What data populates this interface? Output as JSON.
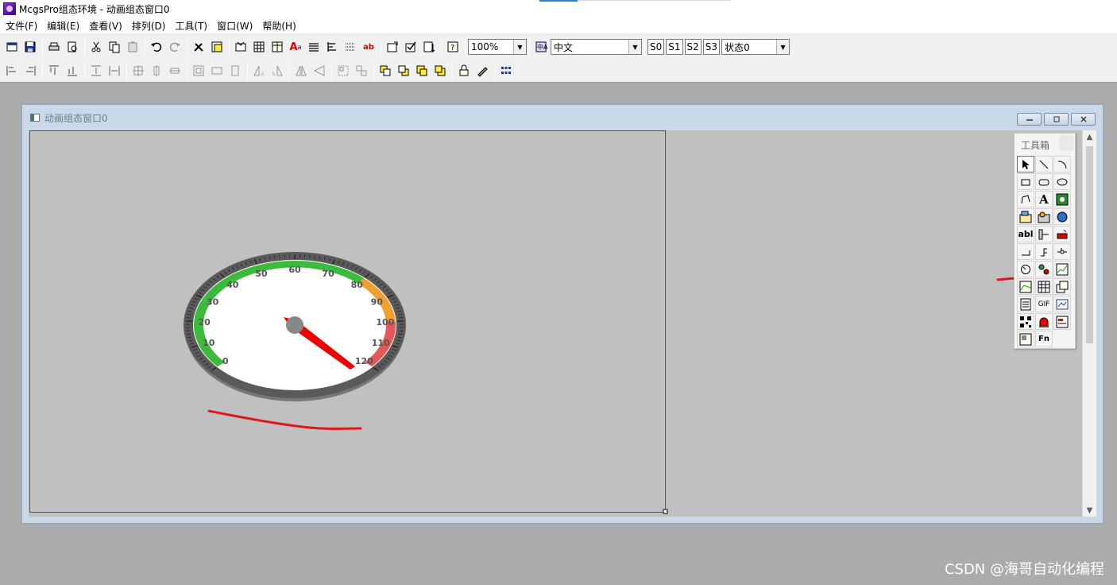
{
  "app": {
    "title": "McgsPro组态环境 - 动画组态窗口0"
  },
  "menu": [
    "文件(F)",
    "编辑(E)",
    "查看(V)",
    "排列(D)",
    "工具(T)",
    "窗口(W)",
    "帮助(H)"
  ],
  "toolbar1": {
    "zoom": "100%",
    "language": "中文",
    "states": [
      "S0",
      "S1",
      "S2",
      "S3"
    ],
    "state_select": "状态0"
  },
  "child_window": {
    "title": "动画组态窗口0"
  },
  "toolbox": {
    "title": "工具箱",
    "fn_label": "Fn",
    "gif_label": "GIF",
    "abl_label": "abl"
  },
  "gauge": {
    "ticks": [
      "0",
      "10",
      "20",
      "30",
      "40",
      "50",
      "60",
      "70",
      "80",
      "90",
      "100",
      "110",
      "120"
    ],
    "colors": {
      "green": "#3cba3c",
      "orange": "#f0a030",
      "red": "#e85858",
      "needle": "#ee0000",
      "hub": "#888888"
    }
  },
  "annotation_color": "#dd1a1a",
  "watermark": "CSDN @海哥自动化编程"
}
